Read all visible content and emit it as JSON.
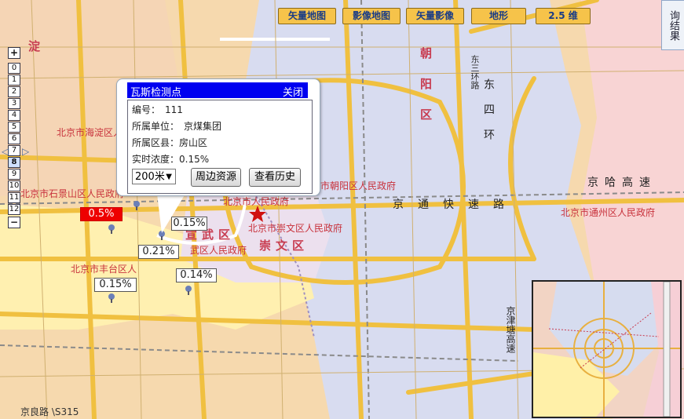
{
  "toolbar": {
    "vector_map": "矢量地图",
    "image_map": "影像地图",
    "vector_image": "矢量影像",
    "terrain": "地形",
    "view_25d": "2.5 维"
  },
  "right_tab": {
    "label": "询结果"
  },
  "zoom": {
    "zoom_in": "+",
    "zoom_out": "−",
    "levels": [
      "0",
      "1",
      "2",
      "3",
      "4",
      "5",
      "6",
      "7",
      "8",
      "9",
      "10",
      "11",
      "12"
    ],
    "selected_level": "8"
  },
  "popup": {
    "title": "瓦斯检测点",
    "close": "关闭",
    "rows": [
      {
        "label": "编号：",
        "value": "111"
      },
      {
        "label": "所属单位：",
        "value": "京煤集团"
      },
      {
        "label": "所属区县：",
        "value": "房山区"
      },
      {
        "label": "实时浓度：",
        "value": "0.15%"
      }
    ],
    "range_select": "200米",
    "nearby_button": "周边资源",
    "history_button": "查看历史"
  },
  "markers": [
    "0.5%",
    "0.15%",
    "0.21%",
    "0.15%",
    "0.14%"
  ],
  "map_labels": {
    "haidian_gov": "北京市海淀区人民政府",
    "shijingshan_gov": "北京市石景山区人民政府",
    "chaoyang_gov": "北京市朝阳区人民政府",
    "tongzhou_gov": "北京市通州区人民政府",
    "people_gov": "北京市人民政府",
    "chongwen_gov": "北京市崇文区人民政府",
    "fengtai_gov": "北京市丰台区人",
    "xuanwu_gov": "武区人民政府",
    "chaoyang_district": "朝阳区",
    "chongwen_district": "崇文区",
    "xuanwu_district": "宣武区",
    "haidian_char": "淀",
    "chaoyang_road": "东三环路",
    "jingliang_road": "京良路 \\S315",
    "east_road": "东四环",
    "tongkuai": "京通快速路",
    "jingha": "京哈高速",
    "jingjin": "京津塘高速"
  },
  "colors": {
    "dongcheng_area": "#d8dcf0",
    "fengtai_area": "#fff2b0",
    "tongzhou_area": "#f6d0d0",
    "road": "#f0c040",
    "alert": "#ee0000",
    "popup_header": "#0000f0"
  }
}
